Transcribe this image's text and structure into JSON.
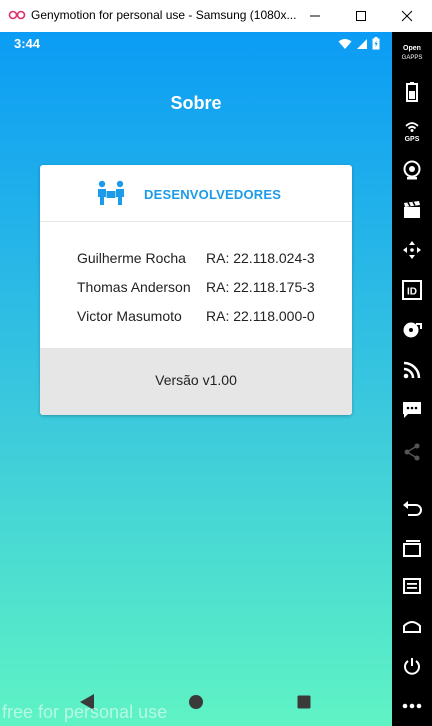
{
  "window": {
    "title": "Genymotion for personal use - Samsung (1080x..."
  },
  "status_bar": {
    "time": "3:44"
  },
  "page": {
    "title": "Sobre"
  },
  "card": {
    "heading": "DESENVOLVEDORES",
    "developers": [
      {
        "name": "Guilherme Rocha",
        "ra": "RA: 22.118.024-3"
      },
      {
        "name": "Thomas Anderson",
        "ra": "RA: 22.118.175-3"
      },
      {
        "name": "Victor Masumoto",
        "ra": "RA: 22.118.000-0"
      }
    ],
    "version": "Versão v1.00"
  },
  "watermark": "free for personal use",
  "sidebar": {
    "gapps_label": "Open GAPPS",
    "gps_label": "GPS",
    "id_label": "ID"
  },
  "colors": {
    "gradient_top": "#0b9cf5",
    "gradient_bottom": "#5ff3c4",
    "accent": "#1c9be8"
  }
}
